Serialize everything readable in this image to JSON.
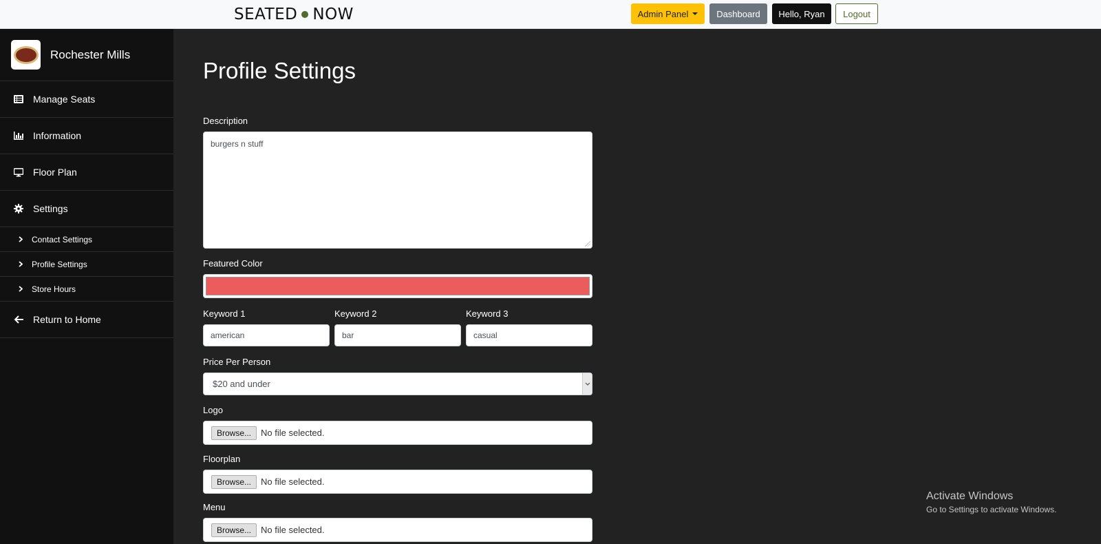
{
  "brand": {
    "left": "SEATED",
    "right": "NOW"
  },
  "nav": {
    "admin_panel": "Admin Panel",
    "dashboard": "Dashboard",
    "hello": "Hello, Ryan",
    "logout": "Logout"
  },
  "sidebar": {
    "restaurant_name": "Rochester Mills",
    "items": [
      {
        "label": "Manage Seats",
        "icon": "list-icon"
      },
      {
        "label": "Information",
        "icon": "bar-chart-icon"
      },
      {
        "label": "Floor Plan",
        "icon": "monitor-icon"
      },
      {
        "label": "Settings",
        "icon": "gear-icon"
      }
    ],
    "sub_items": [
      {
        "label": "Contact Settings"
      },
      {
        "label": "Profile Settings"
      },
      {
        "label": "Store Hours"
      }
    ],
    "return_home": "Return to Home"
  },
  "page": {
    "title": "Profile Settings",
    "description_label": "Description",
    "description_value": "burgers n stuff",
    "featured_color_label": "Featured Color",
    "featured_color_value": "#eb5c5c",
    "keyword1_label": "Keyword 1",
    "keyword1_value": "american",
    "keyword2_label": "Keyword 2",
    "keyword2_value": "bar",
    "keyword3_label": "Keyword 3",
    "keyword3_value": "casual",
    "price_label": "Price Per Person",
    "price_value": "$20 and under",
    "logo_label": "Logo",
    "floorplan_label": "Floorplan",
    "menu_label": "Menu",
    "browse_label": "Browse...",
    "no_file": "No file selected."
  },
  "watermark": {
    "line1": "Activate Windows",
    "line2": "Go to Settings to activate Windows."
  },
  "colors": {
    "accent_yellow": "#ffc107",
    "brand_green": "#4f6b2e",
    "sidebar_bg": "#111111",
    "main_bg": "#222222"
  }
}
